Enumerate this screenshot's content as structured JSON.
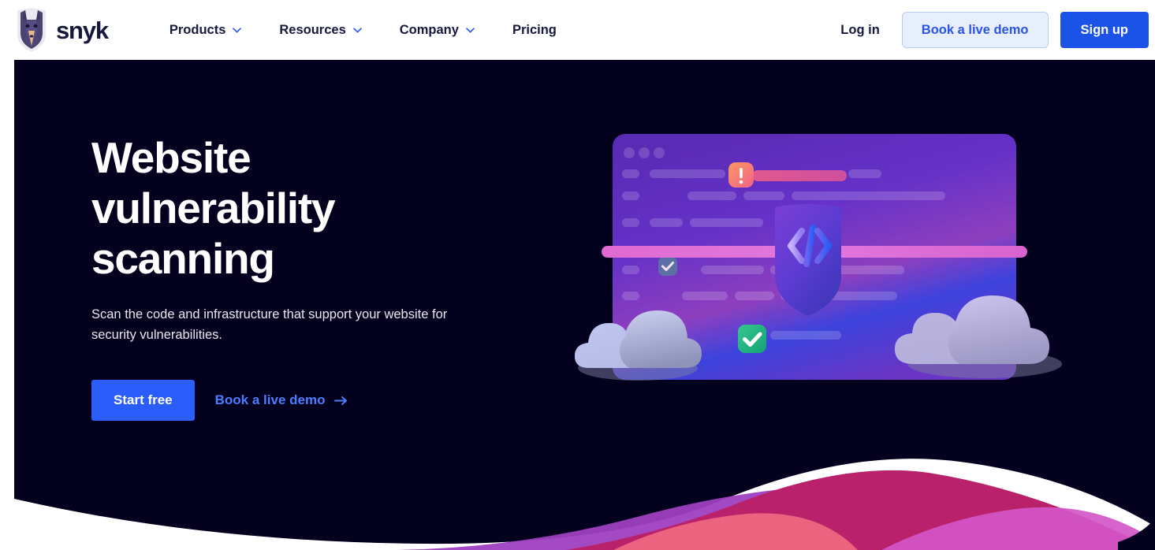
{
  "nav": {
    "brand": {
      "name": "snyk",
      "logo_icon": "snyk-doberman-shield-logo"
    },
    "links": [
      {
        "label": "Products",
        "has_dropdown": true
      },
      {
        "label": "Resources",
        "has_dropdown": true
      },
      {
        "label": "Company",
        "has_dropdown": true
      },
      {
        "label": "Pricing",
        "has_dropdown": false
      }
    ],
    "login_label": "Log in",
    "demo_label": "Book a live demo",
    "signup_label": "Sign up"
  },
  "hero": {
    "title_line1": "Website",
    "title_line2": "vulnerability",
    "title_line3": "scanning",
    "subtitle": "Scan the code and infrastructure that support your website for security vulnerabilities.",
    "primary_cta": "Start free",
    "secondary_cta": "Book a live demo",
    "arrow_icon": "arrow-right-icon"
  },
  "illustration": {
    "window_dots": 3,
    "alert_badge_icon": "exclamation-alert-icon",
    "shield_icon": "shield-code-icon",
    "check_badge_icon": "checkmark-icon",
    "cloud_icon": "cloud-icon"
  },
  "colors": {
    "hero_background": "#04011e",
    "accent_blue": "#2b5dfb",
    "signup_blue": "#1b52e8",
    "demo_button_bg": "#e7eefc",
    "demo_button_text": "#2a54e8",
    "nav_text": "#16183e",
    "wave_purple": "#9e3fc0",
    "wave_crimson": "#b9226b",
    "wave_orchid": "#d456c8",
    "wave_coral": "#ee6782",
    "alert_orange": "#f98a63",
    "check_green": "#18b48a"
  }
}
